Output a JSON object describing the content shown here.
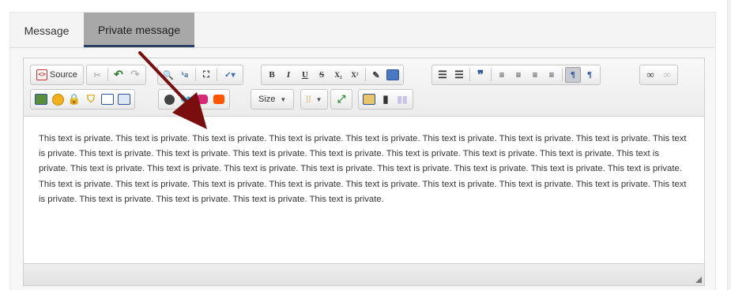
{
  "tabs": [
    {
      "label": "Message"
    },
    {
      "label": "Private message"
    }
  ],
  "toolbar": {
    "source_label": "Source",
    "size_label": "Size"
  },
  "editor": {
    "content": "This text is private. This text is private. This text is private. This text is private. This text is private. This text is private. This text is private. This text is private. This text is private. This text is private. This text is private. This text is private. This text is private. This text is private. This text is private. This text is private. This text is private. This text is private. This text is private. This text is private. This text is private. This text is private. This text is private. This text is private. This text is private. This text is private. This text is private. This text is private. This text is private. This text is private. This text is private. This text is private. This text is private. This text is private. This text is private. This text is private. This text is private. This text is private."
  },
  "colors": {
    "active_tab_bg": "#a8a8a8",
    "active_tab_underline": "#2a3d5e",
    "annotation_arrow": "#7a0e0e"
  }
}
